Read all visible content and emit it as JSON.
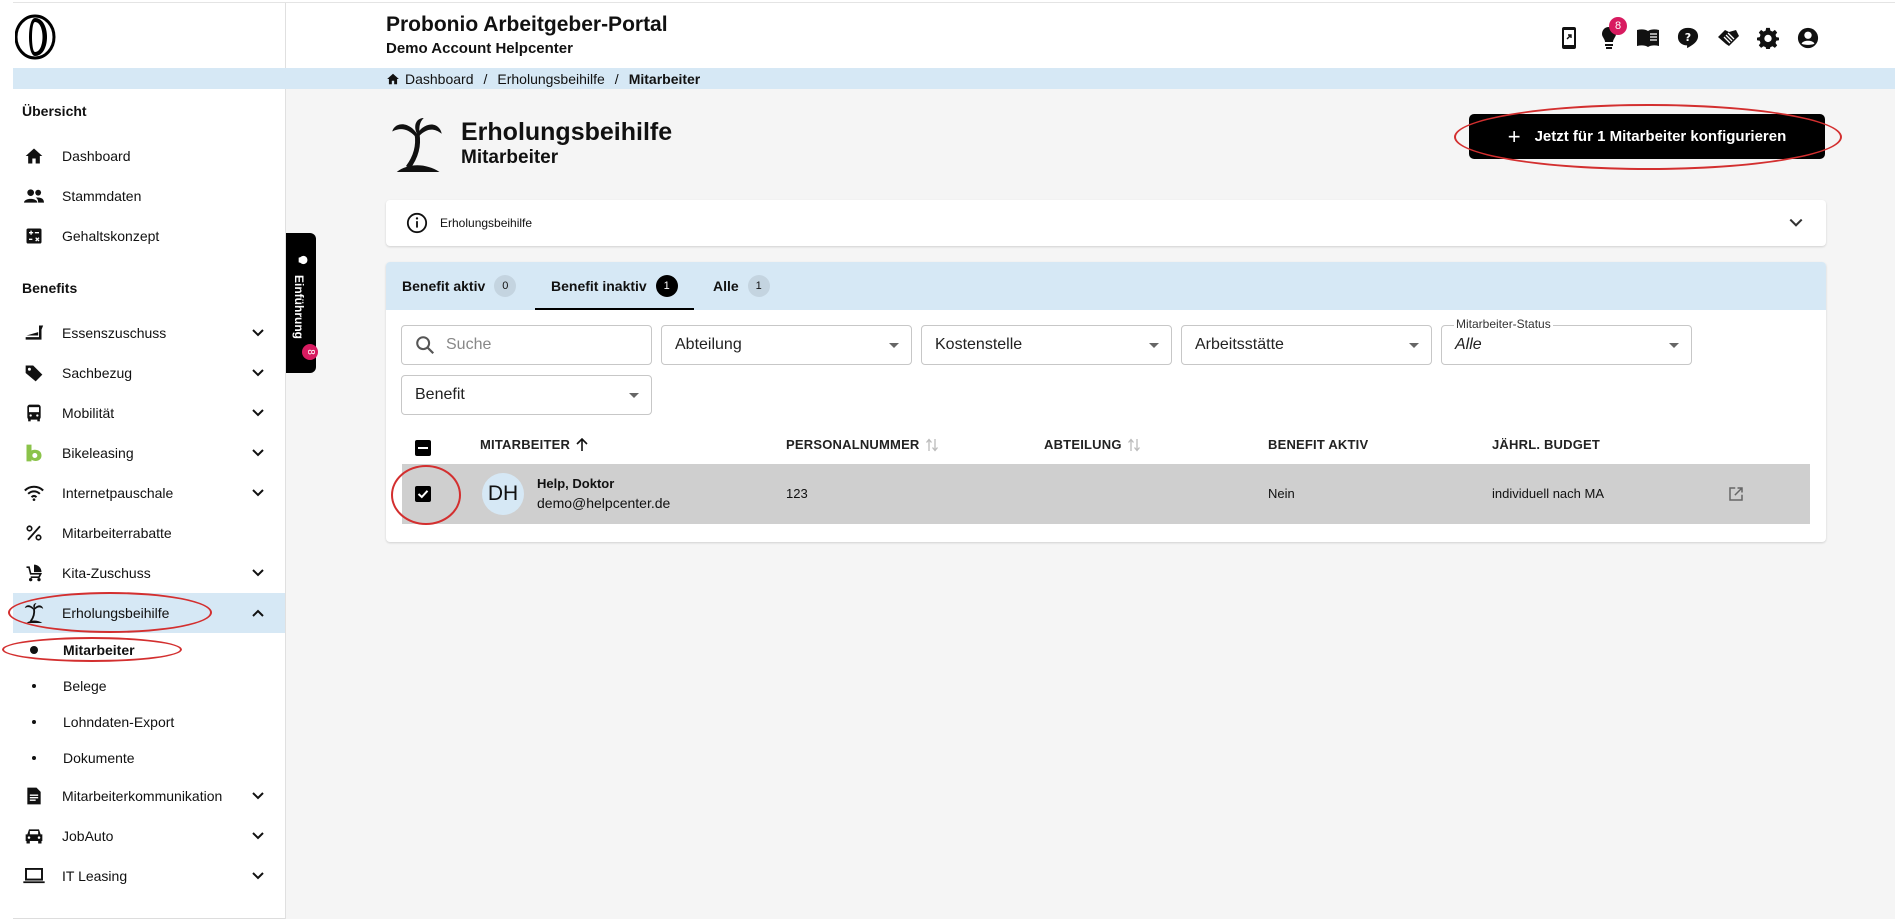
{
  "header": {
    "title": "Probonio Arbeitgeber-Portal",
    "subtitle": "Demo Account Helpcenter",
    "notification_count": "8",
    "icons": [
      "app-download-icon",
      "lightbulb-icon",
      "book-icon",
      "help-icon",
      "handshake-icon",
      "settings-icon",
      "account-icon"
    ]
  },
  "breadcrumb": {
    "items": [
      "Dashboard",
      "Erholungsbeihilfe",
      "Mitarbeiter"
    ],
    "separator": "/"
  },
  "sidebar": {
    "section_overview": "Übersicht",
    "overview_items": [
      {
        "label": "Dashboard",
        "icon": "home-icon"
      },
      {
        "label": "Stammdaten",
        "icon": "people-icon"
      },
      {
        "label": "Gehaltskonzept",
        "icon": "calculator-icon"
      }
    ],
    "section_benefits": "Benefits",
    "benefit_items": [
      {
        "label": "Essenszuschuss",
        "icon": "food-icon"
      },
      {
        "label": "Sachbezug",
        "icon": "tag-icon"
      },
      {
        "label": "Mobilität",
        "icon": "bus-icon"
      },
      {
        "label": "Bikeleasing",
        "icon": "bikeleasing-icon"
      },
      {
        "label": "Internetpauschale",
        "icon": "wifi-icon"
      },
      {
        "label": "Mitarbeiterrabatte",
        "icon": "percent-icon"
      },
      {
        "label": "Kita-Zuschuss",
        "icon": "stroller-icon"
      },
      {
        "label": "Erholungsbeihilfe",
        "icon": "palm-tree-icon"
      }
    ],
    "sub_items": [
      "Mitarbeiter",
      "Belege",
      "Lohndaten-Export",
      "Dokumente"
    ],
    "bottom_items": [
      {
        "label": "Mitarbeiterkommunikation",
        "icon": "document-icon"
      },
      {
        "label": "JobAuto",
        "icon": "car-icon"
      },
      {
        "label": "IT Leasing",
        "icon": "laptop-icon"
      }
    ]
  },
  "intro_tab": {
    "label": "Einführung",
    "badge": "8"
  },
  "page": {
    "title": "Erholungsbeihilfe",
    "subtitle": "Mitarbeiter",
    "cta_label": "Jetzt für 1 Mitarbeiter konfigurieren",
    "info_label": "Erholungsbeihilfe"
  },
  "tabs": [
    {
      "label": "Benefit aktiv",
      "count": "0"
    },
    {
      "label": "Benefit inaktiv",
      "count": "1"
    },
    {
      "label": "Alle",
      "count": "1"
    }
  ],
  "filters": {
    "search_placeholder": "Suche",
    "abteilung": "Abteilung",
    "kostenstelle": "Kostenstelle",
    "arbeitsstaette": "Arbeitsstätte",
    "status_label": "Mitarbeiter-Status",
    "status_value": "Alle",
    "benefit": "Benefit"
  },
  "table": {
    "columns": [
      "MITARBEITER",
      "PERSONALNUMMER",
      "ABTEILUNG",
      "BENEFIT AKTIV",
      "JÄHRL. BUDGET"
    ],
    "rows": [
      {
        "initials": "DH",
        "name": "Help, Doktor",
        "email": "demo@helpcenter.de",
        "personalnummer": "123",
        "abteilung": "",
        "benefit_aktiv": "Nein",
        "budget": "individuell nach MA",
        "selected": true
      }
    ]
  },
  "colors": {
    "accent": "#d6e8f5",
    "badge": "#d81b60",
    "annotation": "#d32f2f",
    "row_selected": "#cfcfcf"
  }
}
